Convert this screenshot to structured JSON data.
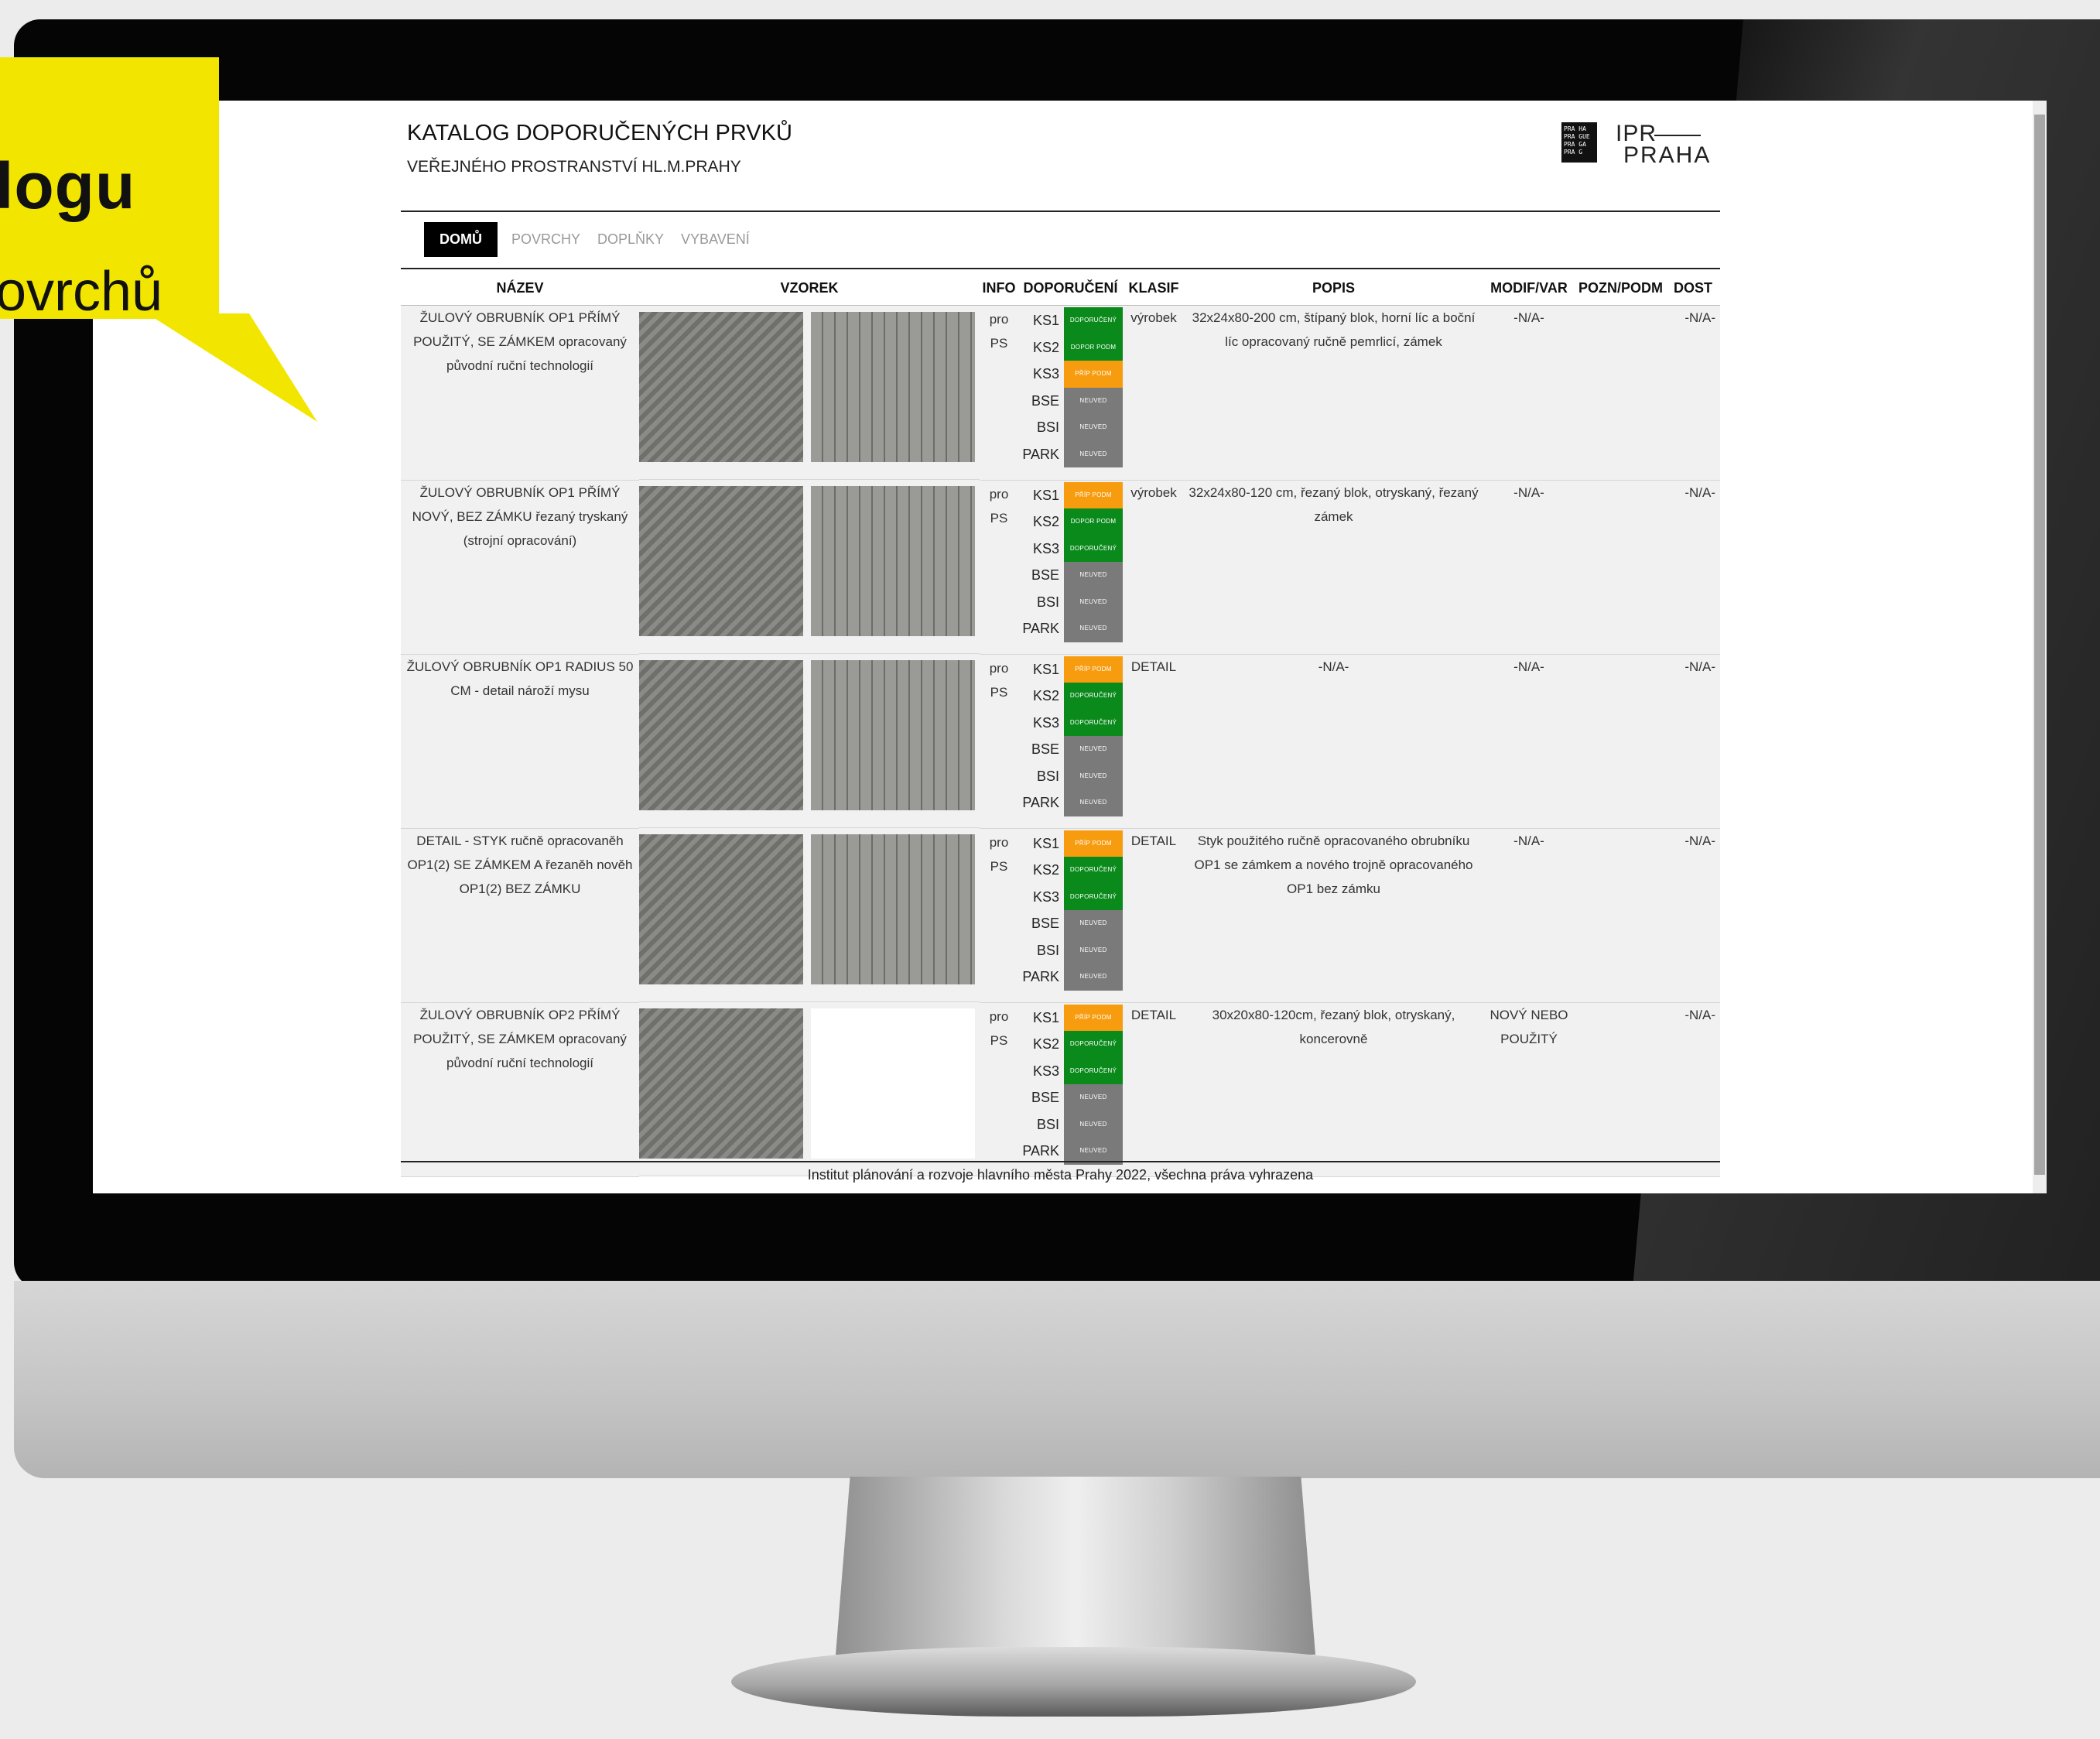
{
  "callout": {
    "line1": "logu",
    "line2": "ovrchů"
  },
  "header": {
    "title": "KATALOG DOPORUČENÝCH PRVKŮ",
    "subtitle": "VEŘEJNÉHO PROSTRANSTVÍ HL.M.PRAHY",
    "logo_mark": "PRA HA PRA GUE PRA GA PRA G",
    "logo_ipr": "IPR",
    "logo_praha": "PRAHA"
  },
  "nav": {
    "items": [
      "DOMŮ",
      "POVRCHY",
      "DOPLŇKY",
      "VYBAVENÍ"
    ],
    "active": "DOMŮ"
  },
  "table": {
    "headers": [
      "NÁZEV",
      "VZOREK",
      "INFO",
      "DOPORUČENÍ",
      "KLASIF",
      "POPIS",
      "MODIF/VAR",
      "POZN/PODM",
      "DOST"
    ],
    "rec_labels": [
      "KS1",
      "KS2",
      "KS3",
      "BSE",
      "BSI",
      "PARK"
    ],
    "rows": [
      {
        "name": "ŽULOVÝ OBRUBNÍK OP1 PŘÍMÝ POUŽITÝ, SE ZÁMKEM opracovaný původní ruční technologií",
        "info": "pro PS",
        "chips": [
          "DOPORUČENÝ",
          "DOPOR PODM",
          "PŘÍP PODM",
          "NEUVED",
          "NEUVED",
          "NEUVED"
        ],
        "chip_colors": [
          "green",
          "green",
          "orange",
          "gray",
          "gray",
          "gray"
        ],
        "klasif": "výrobek",
        "popis": "32x24x80-200 cm, štípaný blok, horní líc a boční líc opracovaný ručně pemrlicí, zámek",
        "modif": "-N/A-",
        "pozn": "",
        "dost": "-N/A-",
        "photos": [
          "paving-curb-photo",
          "cobble-curb-photo"
        ]
      },
      {
        "name": "ŽULOVÝ OBRUBNÍK OP1 PŘÍMÝ NOVÝ, BEZ ZÁMKU řezaný tryskaný (strojní opracování)",
        "info": "pro PS",
        "chips": [
          "PŘÍP PODM",
          "DOPOR PODM",
          "DOPORUČENÝ",
          "NEUVED",
          "NEUVED",
          "NEUVED"
        ],
        "chip_colors": [
          "orange",
          "green",
          "green",
          "gray",
          "gray",
          "gray"
        ],
        "klasif": "výrobek",
        "popis": "32x24x80-120 cm, řezaný blok, otryskaný, řezaný zámek",
        "modif": "-N/A-",
        "pozn": "",
        "dost": "-N/A-",
        "photos": [
          "paving-curb-photo",
          "cobble-curb-photo"
        ]
      },
      {
        "name": "ŽULOVÝ OBRUBNÍK OP1 RADIUS 50 CM - detail nároží mysu",
        "info": "pro PS",
        "chips": [
          "PŘÍP PODM",
          "DOPORUČENÝ",
          "DOPORUČENÝ",
          "NEUVED",
          "NEUVED",
          "NEUVED"
        ],
        "chip_colors": [
          "orange",
          "green",
          "green",
          "gray",
          "gray",
          "gray"
        ],
        "klasif": "DETAIL",
        "popis": "-N/A-",
        "modif": "-N/A-",
        "pozn": "",
        "dost": "-N/A-",
        "photos": [
          "paving-curb-photo",
          "cobble-curb-photo"
        ]
      },
      {
        "name": "DETAIL - STYK ručně opracovaněh OP1(2) SE ZÁMKEM A řezaněh nověh OP1(2) BEZ ZÁMKU",
        "info": "pro PS",
        "chips": [
          "PŘÍP PODM",
          "DOPORUČENÝ",
          "DOPORUČENÝ",
          "NEUVED",
          "NEUVED",
          "NEUVED"
        ],
        "chip_colors": [
          "orange",
          "green",
          "green",
          "gray",
          "gray",
          "gray"
        ],
        "klasif": "DETAIL",
        "popis": "Styk použitého ručně opracovaného obrubníku OP1 se zámkem a nového trojně opracovaného OP1 bez zámku",
        "modif": "-N/A-",
        "pozn": "",
        "dost": "-N/A-",
        "photos": [
          "paving-curb-photo",
          "cobble-curb-photo"
        ]
      },
      {
        "name": "ŽULOVÝ OBRUBNÍK OP2 PŘÍMÝ POUŽITÝ, SE ZÁMKEM opracovaný původní ruční technologií",
        "info": "pro PS",
        "chips": [
          "PŘÍP PODM",
          "DOPORUČENÝ",
          "DOPORUČENÝ",
          "NEUVED",
          "NEUVED",
          "NEUVED"
        ],
        "chip_colors": [
          "orange",
          "green",
          "green",
          "gray",
          "gray",
          "gray"
        ],
        "klasif": "DETAIL",
        "popis": "30x20x80-120cm, řezaný blok, otryskaný, koncerovně",
        "modif": "NOVÝ NEBO POUŽITÝ",
        "pozn": "",
        "dost": "-N/A-",
        "photos": [
          "paving-curb-photo",
          ""
        ]
      }
    ]
  },
  "footer": {
    "text": "Institut plánování a rozvoje hlavního města Prahy 2022, všechna práva vyhrazena"
  },
  "colors": {
    "callout": "#f2e600",
    "recommended": "#0b8a1c",
    "conditional": "#f79c0f",
    "unspecified": "#7a7a7a"
  }
}
